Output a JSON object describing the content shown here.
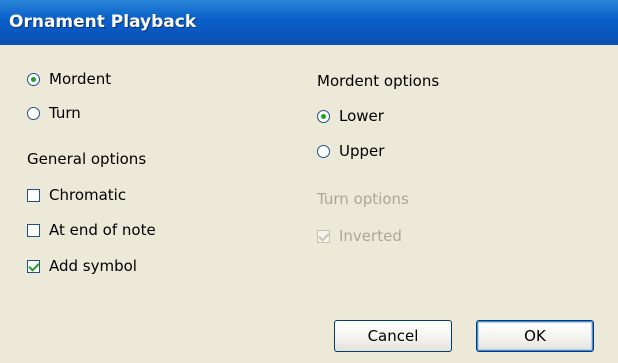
{
  "window": {
    "title": "Ornament Playback"
  },
  "type_options": [
    {
      "label": "Mordent",
      "checked": true
    },
    {
      "label": "Turn",
      "checked": false
    }
  ],
  "general_options": {
    "label": "General options",
    "items": [
      {
        "label": "Chromatic",
        "checked": false
      },
      {
        "label": "At end of note",
        "checked": false
      },
      {
        "label": "Add symbol",
        "checked": true
      }
    ]
  },
  "mordent_options": {
    "label": "Mordent options",
    "items": [
      {
        "label": "Lower",
        "checked": true
      },
      {
        "label": "Upper",
        "checked": false
      }
    ]
  },
  "turn_options": {
    "label": "Turn options",
    "enabled": false,
    "items": [
      {
        "label": "Inverted",
        "checked": true
      }
    ]
  },
  "buttons": {
    "cancel_label": "Cancel",
    "ok_label": "OK"
  }
}
